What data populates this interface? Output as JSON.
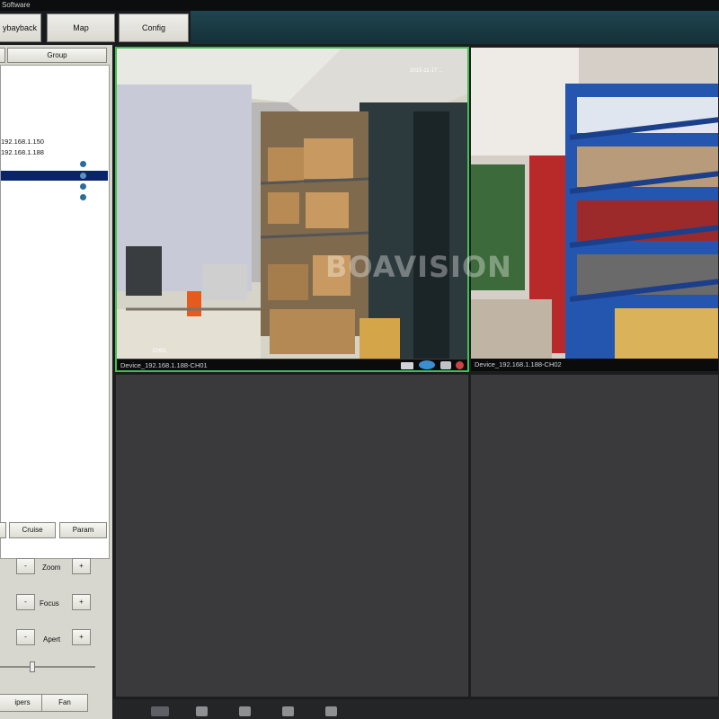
{
  "window": {
    "title": "Software"
  },
  "toolbar": {
    "playback_label": "ybayback",
    "map_label": "Map",
    "config_label": "Config"
  },
  "left_panel": {
    "group_label": "Group",
    "devices": [
      {
        "label": "192.168.1.150",
        "selected": false
      },
      {
        "label": "192.168.1.188",
        "selected": false
      }
    ],
    "channels": [
      {
        "selected": false
      },
      {
        "selected": true
      },
      {
        "selected": false
      },
      {
        "selected": false
      }
    ],
    "ptz": {
      "cruise_label": "Cruise",
      "param_label": "Param",
      "zoom_label": "Zoom",
      "focus_label": "Focus",
      "apert_label": "Apert",
      "minus": "-",
      "plus": "+",
      "speed_level": 0.33,
      "wipers_label": "ipers",
      "fan_label": "Fan"
    }
  },
  "video_grid": {
    "cells": [
      {
        "caption": "Device_192.168.1.188-CH01",
        "active": true,
        "overlay_time": "2015-11-17 ...",
        "overlay_name": "CH01"
      },
      {
        "caption": "Device_192.168.1.188-CH02",
        "active": false
      },
      {
        "caption": "",
        "active": false
      },
      {
        "caption": "",
        "active": false
      }
    ],
    "watermark": "BOAVISION"
  },
  "colors": {
    "active_border": "#3fbf4f",
    "selection": "#0a246a",
    "accent": "#1f4550"
  }
}
